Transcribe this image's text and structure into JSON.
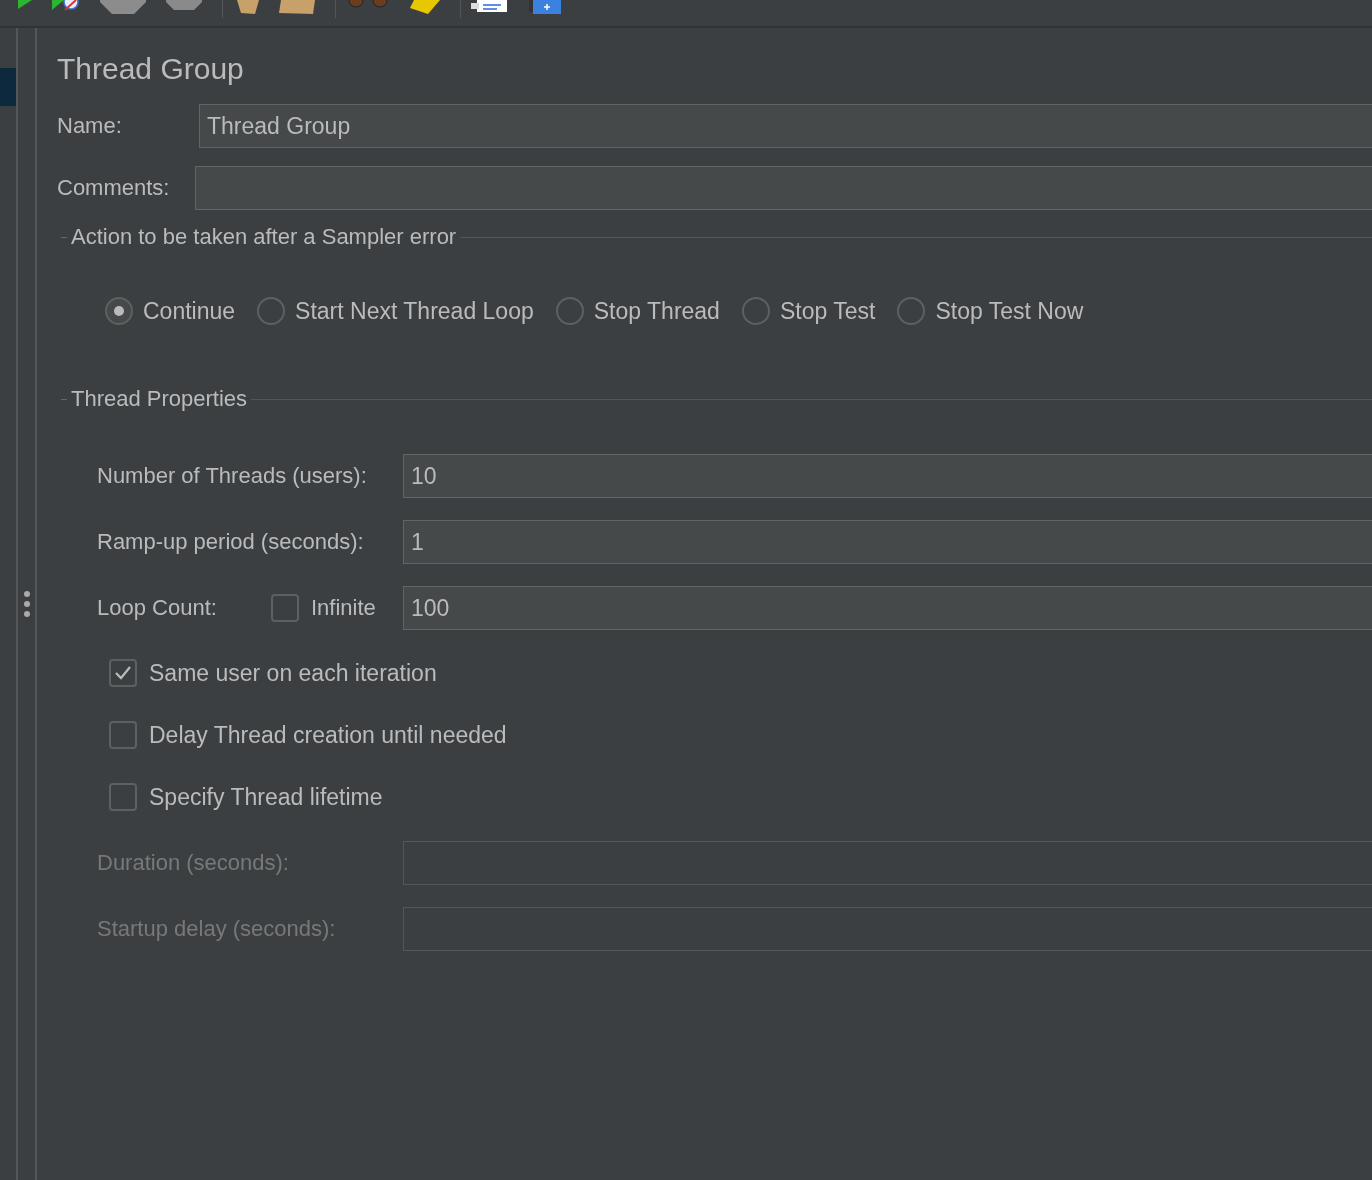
{
  "title": "Thread Group",
  "name_field": {
    "label": "Name:",
    "value": "Thread Group"
  },
  "comments_field": {
    "label": "Comments:"
  },
  "sampler_error_action": {
    "legend": "Action to be taken after a Sampler error",
    "options": [
      {
        "label": "Continue",
        "selected": true
      },
      {
        "label": "Start Next Thread Loop",
        "selected": false
      },
      {
        "label": "Stop Thread",
        "selected": false
      },
      {
        "label": "Stop Test",
        "selected": false
      },
      {
        "label": "Stop Test Now",
        "selected": false
      }
    ]
  },
  "thread_properties": {
    "legend": "Thread Properties",
    "threads": {
      "label": "Number of Threads (users):",
      "value": "10"
    },
    "ramp_up": {
      "label": "Ramp-up period (seconds):",
      "value": "1"
    },
    "loop_count": {
      "label": "Loop Count:",
      "infinite": {
        "label": "Infinite",
        "checked": false
      },
      "value": "100"
    },
    "options": [
      {
        "label": "Same user on each iteration",
        "checked": true
      },
      {
        "label": "Delay Thread creation until needed",
        "checked": false
      },
      {
        "label": "Specify Thread lifetime",
        "checked": false
      }
    ],
    "duration": {
      "label": "Duration (seconds):",
      "disabled": true
    },
    "startup_delay": {
      "label": "Startup delay (seconds):",
      "disabled": true
    }
  }
}
